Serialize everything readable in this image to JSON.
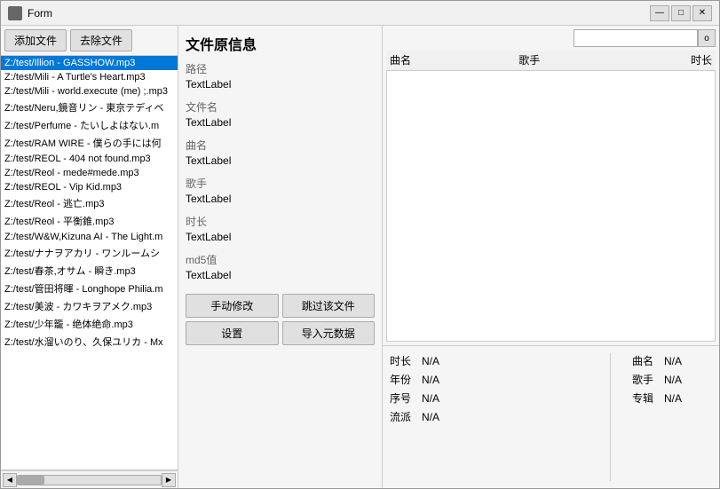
{
  "window": {
    "title": "Form",
    "controls": {
      "minimize": "—",
      "maximize": "□",
      "close": "✕"
    }
  },
  "toolbar": {
    "add_file": "添加文件",
    "remove_file": "去除文件"
  },
  "file_list": [
    "Z:/test/Illion - GASSHOW.mp3",
    "Z:/test/Mili - A Turtle's Heart.mp3",
    "Z:/test/Mili - world.execute (me) ;.mp3",
    "Z:/test/Neru,鏡音リン - 東京テディベ",
    "Z:/test/Perfume - たいしよはない.m",
    "Z:/test/RAM WIRE - 僕らの手には何",
    "Z:/test/REOL - 404 not found.mp3",
    "Z:/test/Reol - mede#mede.mp3",
    "Z:/test/REOL - Vip Kid.mp3",
    "Z:/test/Reol - 逃亡.mp3",
    "Z:/test/Reol - 平衡錐.mp3",
    "Z:/test/W&W,Kizuna AI - The Light.m",
    "Z:/test/ナナヲアカリ - ワンルームシ",
    "Z:/test/春茶,オサム - 瞬き.mp3",
    "Z:/test/管田将暉 - Longhope Philia.m",
    "Z:/test/美波 - カワキヲアメク.mp3",
    "Z:/test/少年籠 - 绝体绝命.mp3",
    "Z:/test/水溜いのり、久保ユリカ - Mx"
  ],
  "middle_panel": {
    "title": "文件原信息",
    "path_label": "路径",
    "path_value": "TextLabel",
    "filename_label": "文件名",
    "filename_value": "TextLabel",
    "song_label": "曲名",
    "song_value": "TextLabel",
    "artist_label": "歌手",
    "artist_value": "TextLabel",
    "duration_label": "时长",
    "duration_value": "TextLabel",
    "md5_label": "md5值",
    "md5_value": "TextLabel",
    "actions": {
      "manual_edit": "手动修改",
      "skip_file": "跳过该文件",
      "settings": "设置",
      "import_meta": "导入元数据"
    }
  },
  "right_panel": {
    "search_placeholder": "",
    "search_btn": "o",
    "columns": {
      "title": "曲名",
      "artist": "歌手",
      "duration": "时长"
    }
  },
  "meta_bottom": {
    "left": {
      "duration_key": "时长",
      "duration_val": "N/A",
      "year_key": "年份",
      "year_val": "N/A",
      "tracknum_key": "序号",
      "tracknum_val": "N/A",
      "genre_key": "流派",
      "genre_val": "N/A"
    },
    "right": {
      "title_key": "曲名",
      "title_val": "N/A",
      "artist_key": "歌手",
      "artist_val": "N/A",
      "album_key": "专辑",
      "album_val": "N/A"
    }
  }
}
